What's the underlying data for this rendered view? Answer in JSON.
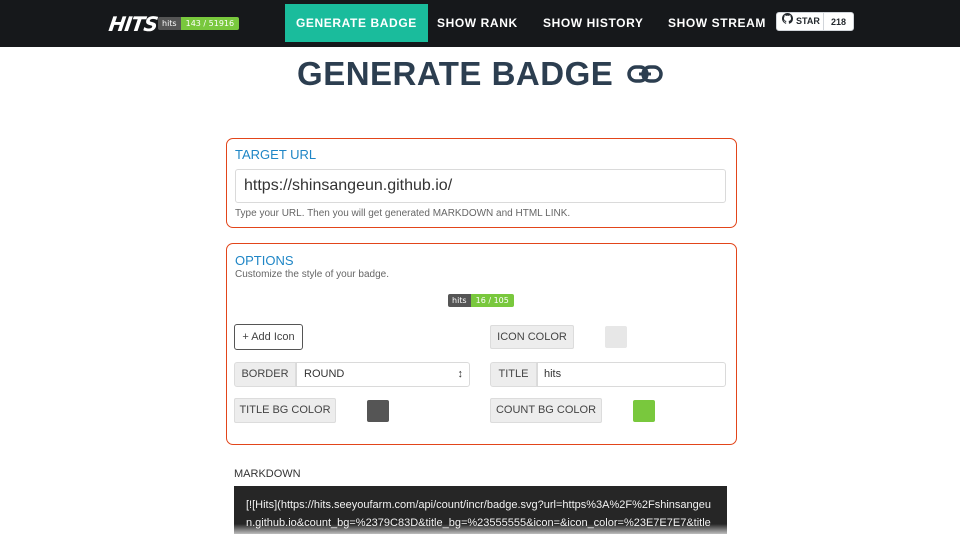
{
  "nav": {
    "logo": "HITS",
    "badge": {
      "title": "hits",
      "count": "143 / 51916"
    },
    "links": [
      "GENERATE BADGE",
      "SHOW RANK",
      "SHOW HISTORY",
      "SHOW STREAM"
    ],
    "star": {
      "label": "STAR",
      "count": "218"
    }
  },
  "page": {
    "title": "GENERATE BADGE"
  },
  "target": {
    "heading": "TARGET URL",
    "url_value": "https://shinsangeun.github.io/",
    "helper": "Type your URL. Then you will get generated MARKDOWN and HTML LINK."
  },
  "options": {
    "heading": "OPTIONS",
    "subtitle": "Customize the style of your badge.",
    "preview_badge": {
      "title": "hits",
      "count": "16 / 105"
    },
    "add_icon_label": "+ Add Icon",
    "icon_color_label": "ICON COLOR",
    "icon_color": "#e7e7e7",
    "border_label": "BORDER",
    "border_value": "ROUND",
    "title_label": "TITLE",
    "title_value": "hits",
    "title_bg_label": "TITLE BG COLOR",
    "title_bg_color": "#555555",
    "count_bg_label": "COUNT BG COLOR",
    "count_bg_color": "#79c83d"
  },
  "markdown": {
    "label": "MARKDOWN",
    "value": "[![Hits](https://hits.seeyoufarm.com/api/count/incr/badge.svg?url=https%3A%2F%2Fshinsangeun.github.io&count_bg=%2379C83D&title_bg=%23555555&icon=&icon_color=%23E7E7E7&title=hits&edge_flat=false)](https://hits.seeyoufarm.com)"
  },
  "colors": {
    "nav_bg": "#16181b",
    "accent": "#1abc9c",
    "panel_border": "#e2451a",
    "heading_blue": "#1f86c6"
  }
}
